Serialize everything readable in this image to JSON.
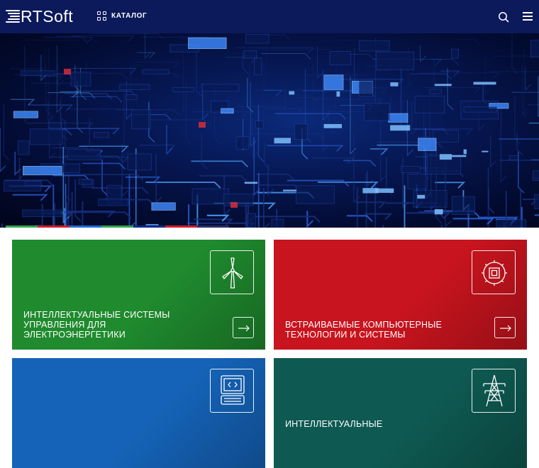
{
  "header": {
    "logo_text": "RTSoft",
    "catalog_label": "КАТАЛОГ",
    "search_icon": "search-icon",
    "menu_icon": "hamburger-menu-icon"
  },
  "hero": {
    "image": "circuit-board-image",
    "slider_colors": [
      "#2fa84f",
      "#d21f2b",
      "#1e6fd9",
      "#2fa84f",
      "#0f2a8a",
      "#d21f2b",
      "#2a2f6a"
    ]
  },
  "cards": [
    {
      "title": "Интеллектуальные системы управления для электроэнергетики",
      "icon": "wind-turbine-icon",
      "arrow": "arrow-right-icon",
      "color": "#1f8a2e"
    },
    {
      "title": "Встраиваемые компьютерные технологии и системы",
      "icon": "chip-gear-icon",
      "arrow": "arrow-right-icon",
      "color": "#c8141e"
    },
    {
      "title": "",
      "icon": "computer-terminal-icon",
      "arrow": "arrow-right-icon",
      "color": "#1563b8"
    },
    {
      "title": "Интеллектуальные",
      "icon": "power-tower-icon",
      "arrow": "arrow-right-icon",
      "color": "#0e5a52"
    }
  ]
}
